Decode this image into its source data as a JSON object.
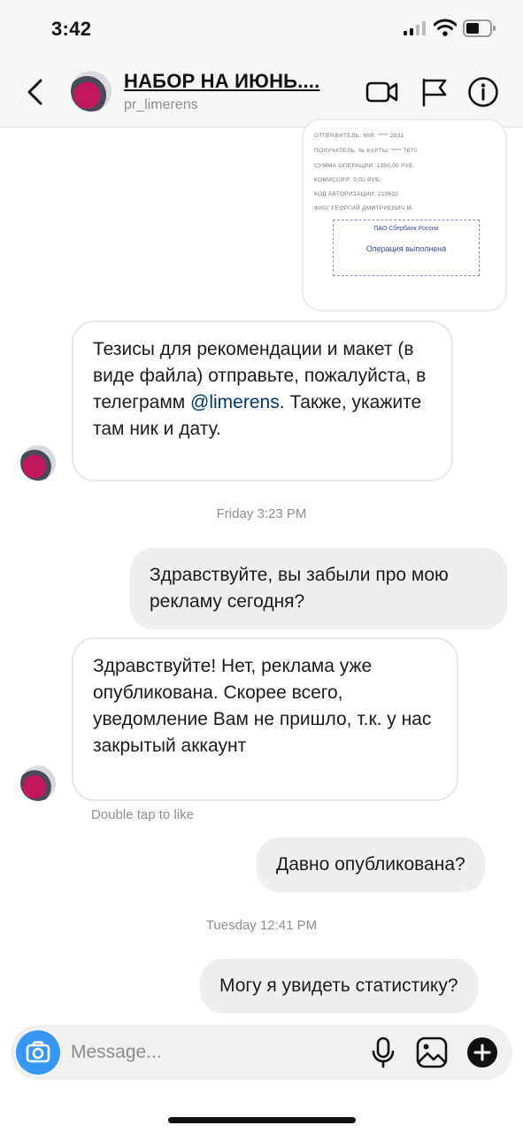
{
  "status_bar": {
    "time": "3:42",
    "icons": [
      "cellular-signal-icon",
      "wifi-icon",
      "battery-icon"
    ]
  },
  "header": {
    "title": "НАБОР НА ИЮНЬ....",
    "username": "pr_limerens",
    "icons": [
      "back-chevron-icon",
      "video-call-icon",
      "flag-icon",
      "info-icon"
    ]
  },
  "receipt": {
    "lines": [
      "ОТПРАВИТЕЛЬ: MIR: **** 2031",
      "ПОЛУЧАТЕЛЬ: № КАРТЫ: **** 7670",
      "СУММА ОПЕРАЦИИ: 1350.00 РУБ.",
      "КОМИССИЯ: 0.00 РУБ.",
      "КОД АВТОРИЗАЦИИ: 210632",
      "ФИО: ГЕОРГИЙ ДМИТРИЕВИЧ М."
    ],
    "bank": "ПАО Сбербанк России",
    "status": "Операция выполнена"
  },
  "messages": {
    "m1_before": "Тезисы для рекомендации и макет (в виде файла) отправьте, пожалуйста, в телеграмм ",
    "m1_mention": "@limerens",
    "m1_after": ". Также, укажите там ник и дату.",
    "ts1": "Friday 3:23 PM",
    "m2": "Здравствуйте, вы забыли про мою рекламу сегодня?",
    "m3": "Здравствуйте! Нет, реклама уже опубликована. Скорее всего, уведомление Вам не пришло, т.к. у нас закрытый аккаунт",
    "hint": "Double tap to like",
    "m4": "Давно опубликована?",
    "ts2": "Tuesday 12:41 PM",
    "m5": "Могу я увидеть статистику?"
  },
  "composer": {
    "placeholder": "Message...",
    "value": "",
    "icons": [
      "camera-icon",
      "microphone-icon",
      "gallery-icon",
      "add-icon"
    ]
  },
  "colors": {
    "camera_button": "#3797f0",
    "mention": "#00376b",
    "outgoing_bubble": "#efefef",
    "muted_text": "#8e8e8e"
  }
}
